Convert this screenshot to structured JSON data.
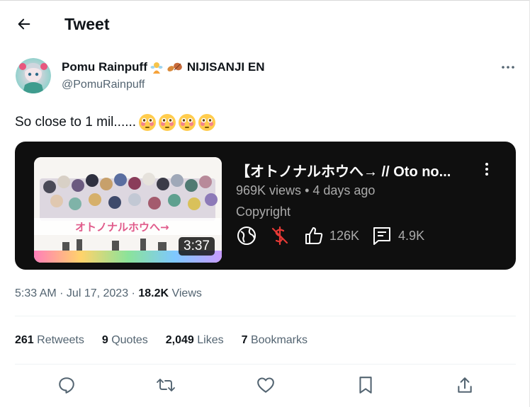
{
  "header": {
    "title": "Tweet",
    "back_icon": "arrow-left-icon"
  },
  "author": {
    "display_name": "Pomu Rainpuff",
    "org_suffix": "NIJISANJI EN",
    "handle": "@PomuRainpuff"
  },
  "tweet": {
    "text": "So close to 1 mil......",
    "emoji_count": 4,
    "timestamp": "5:33 AM · Jul 17, 2023 · ",
    "views_count": "18.2K",
    "views_label": " Views"
  },
  "video_card": {
    "title": "【オトノナルホウへ→ // Oto no...",
    "views": "969K views",
    "separator": " • ",
    "age": "4 days ago",
    "copyright": "Copyright",
    "likes": "126K",
    "comments": "4.9K",
    "duration": "3:37",
    "thumb_caption": "オトノナルホウへ→"
  },
  "stats": {
    "retweets_count": "261",
    "retweets_label": " Retweets",
    "quotes_count": "9",
    "quotes_label": " Quotes",
    "likes_count": "2,049",
    "likes_label": " Likes",
    "bookmarks_count": "7",
    "bookmarks_label": " Bookmarks"
  },
  "actions": [
    "reply-icon",
    "retweet-icon",
    "like-icon",
    "bookmark-icon",
    "share-icon"
  ],
  "colors": {
    "text": "#0f1419",
    "secondary": "#536471",
    "card_bg": "#0f0f0f",
    "card_text": "#aaaaaa",
    "red": "#e53935"
  }
}
